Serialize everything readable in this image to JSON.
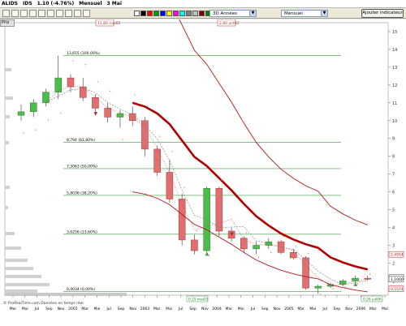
{
  "window": {
    "symbol": "ALIDS",
    "code": "IDS",
    "quote": "1.10 (-4.76%)",
    "period": "Mensuel",
    "date": "3 Mai"
  },
  "toolbar": {
    "chart_type": "3D Années",
    "timeframe": "Mensuel",
    "add_indicator": "Ajouter indicateur",
    "swatch_colors": [
      "#ffffff",
      "#000000",
      "#ff0000",
      "#00a000",
      "#0000ff",
      "#ffff00",
      "#ff00ff",
      "#00ffff",
      "#808080",
      "#c0c0c0",
      "#800000",
      "#008000",
      "#000080",
      "#808000",
      "#800080",
      "#008080"
    ]
  },
  "chart": {
    "tab_label": "Prix",
    "top_flags": [
      "11,80 mai02",
      "2,80 oct03"
    ],
    "bottom_flags": [
      "0,25 mai03",
      "0,26 juil06"
    ],
    "fib_levels": [
      {
        "label": "13,655 (100,00%)",
        "value": 13.655
      },
      {
        "label": "8,794 (61,80%)",
        "value": 8.794
      },
      {
        "label": "7,3063 (50,00%)",
        "value": 7.3063
      },
      {
        "label": "5,8036 (38,20%)",
        "value": 5.8036
      },
      {
        "label": "3,6256 (23,60%)",
        "value": 3.6256
      },
      {
        "label": "0,4034 (0,00%)",
        "value": 0.4034
      }
    ],
    "right_badges": [
      "2,4914",
      "1,2000",
      "1,1000",
      "0,5574"
    ],
    "y_ticks": [
      1,
      2,
      3,
      4,
      5,
      6,
      7,
      8,
      9,
      10,
      11,
      12,
      13,
      14,
      15
    ],
    "x_months": [
      "Mar",
      "Mai",
      "Jul",
      "Sep",
      "Nov",
      "2002",
      "Mar",
      "Mai",
      "Jul",
      "Sep",
      "Nov",
      "2003",
      "Mar",
      "Mai",
      "Jul",
      "Sep",
      "Nov",
      "2004",
      "Mar",
      "Mai",
      "Jul",
      "Sep",
      "Nov",
      "2005",
      "Mar",
      "Mai",
      "Jul",
      "Sep",
      "Nov",
      "2006",
      "Mar",
      "Mai"
    ],
    "footer": "© ProRealTime.com  Données en temps réel"
  },
  "chart_data": {
    "type": "candlestick",
    "ylim": [
      0.2,
      15.5
    ],
    "candles": [
      {
        "o": 10.3,
        "h": 10.9,
        "l": 10.0,
        "c": 10.5
      },
      {
        "o": 10.5,
        "h": 11.2,
        "l": 10.2,
        "c": 11.0
      },
      {
        "o": 11.0,
        "h": 11.8,
        "l": 10.8,
        "c": 11.6
      },
      {
        "o": 11.6,
        "h": 13.65,
        "l": 11.2,
        "c": 12.4
      },
      {
        "o": 12.4,
        "h": 12.6,
        "l": 11.6,
        "c": 11.9
      },
      {
        "o": 11.9,
        "h": 12.4,
        "l": 11.1,
        "c": 11.3
      },
      {
        "o": 11.3,
        "h": 11.5,
        "l": 10.4,
        "c": 10.7
      },
      {
        "o": 10.7,
        "h": 11.0,
        "l": 9.9,
        "c": 10.2
      },
      {
        "o": 10.2,
        "h": 10.6,
        "l": 9.6,
        "c": 10.4
      },
      {
        "o": 10.4,
        "h": 10.8,
        "l": 9.7,
        "c": 10.0
      },
      {
        "o": 10.0,
        "h": 10.2,
        "l": 8.0,
        "c": 8.4
      },
      {
        "o": 8.4,
        "h": 8.6,
        "l": 6.9,
        "c": 7.1
      },
      {
        "o": 7.1,
        "h": 7.8,
        "l": 5.4,
        "c": 5.6
      },
      {
        "o": 5.6,
        "h": 5.9,
        "l": 3.0,
        "c": 3.3
      },
      {
        "o": 3.3,
        "h": 3.6,
        "l": 2.5,
        "c": 2.7
      },
      {
        "o": 2.7,
        "h": 6.3,
        "l": 2.6,
        "c": 6.2
      },
      {
        "o": 6.2,
        "h": 6.3,
        "l": 3.5,
        "c": 3.8
      },
      {
        "o": 3.8,
        "h": 4.0,
        "l": 3.2,
        "c": 3.4
      },
      {
        "o": 3.4,
        "h": 3.5,
        "l": 2.6,
        "c": 2.8
      },
      {
        "o": 2.8,
        "h": 3.2,
        "l": 2.5,
        "c": 3.0
      },
      {
        "o": 3.0,
        "h": 3.4,
        "l": 2.8,
        "c": 3.2
      },
      {
        "o": 3.2,
        "h": 3.3,
        "l": 2.5,
        "c": 2.6
      },
      {
        "o": 2.6,
        "h": 2.8,
        "l": 2.2,
        "c": 2.3
      },
      {
        "o": 2.3,
        "h": 2.4,
        "l": 0.5,
        "c": 0.6
      },
      {
        "o": 0.6,
        "h": 0.8,
        "l": 0.26,
        "c": 0.7
      },
      {
        "o": 0.7,
        "h": 0.9,
        "l": 0.6,
        "c": 0.8
      },
      {
        "o": 0.8,
        "h": 1.1,
        "l": 0.7,
        "c": 1.0
      },
      {
        "o": 1.0,
        "h": 1.3,
        "l": 0.9,
        "c": 1.15
      },
      {
        "o": 1.15,
        "h": 1.3,
        "l": 1.0,
        "c": 1.1
      }
    ]
  }
}
